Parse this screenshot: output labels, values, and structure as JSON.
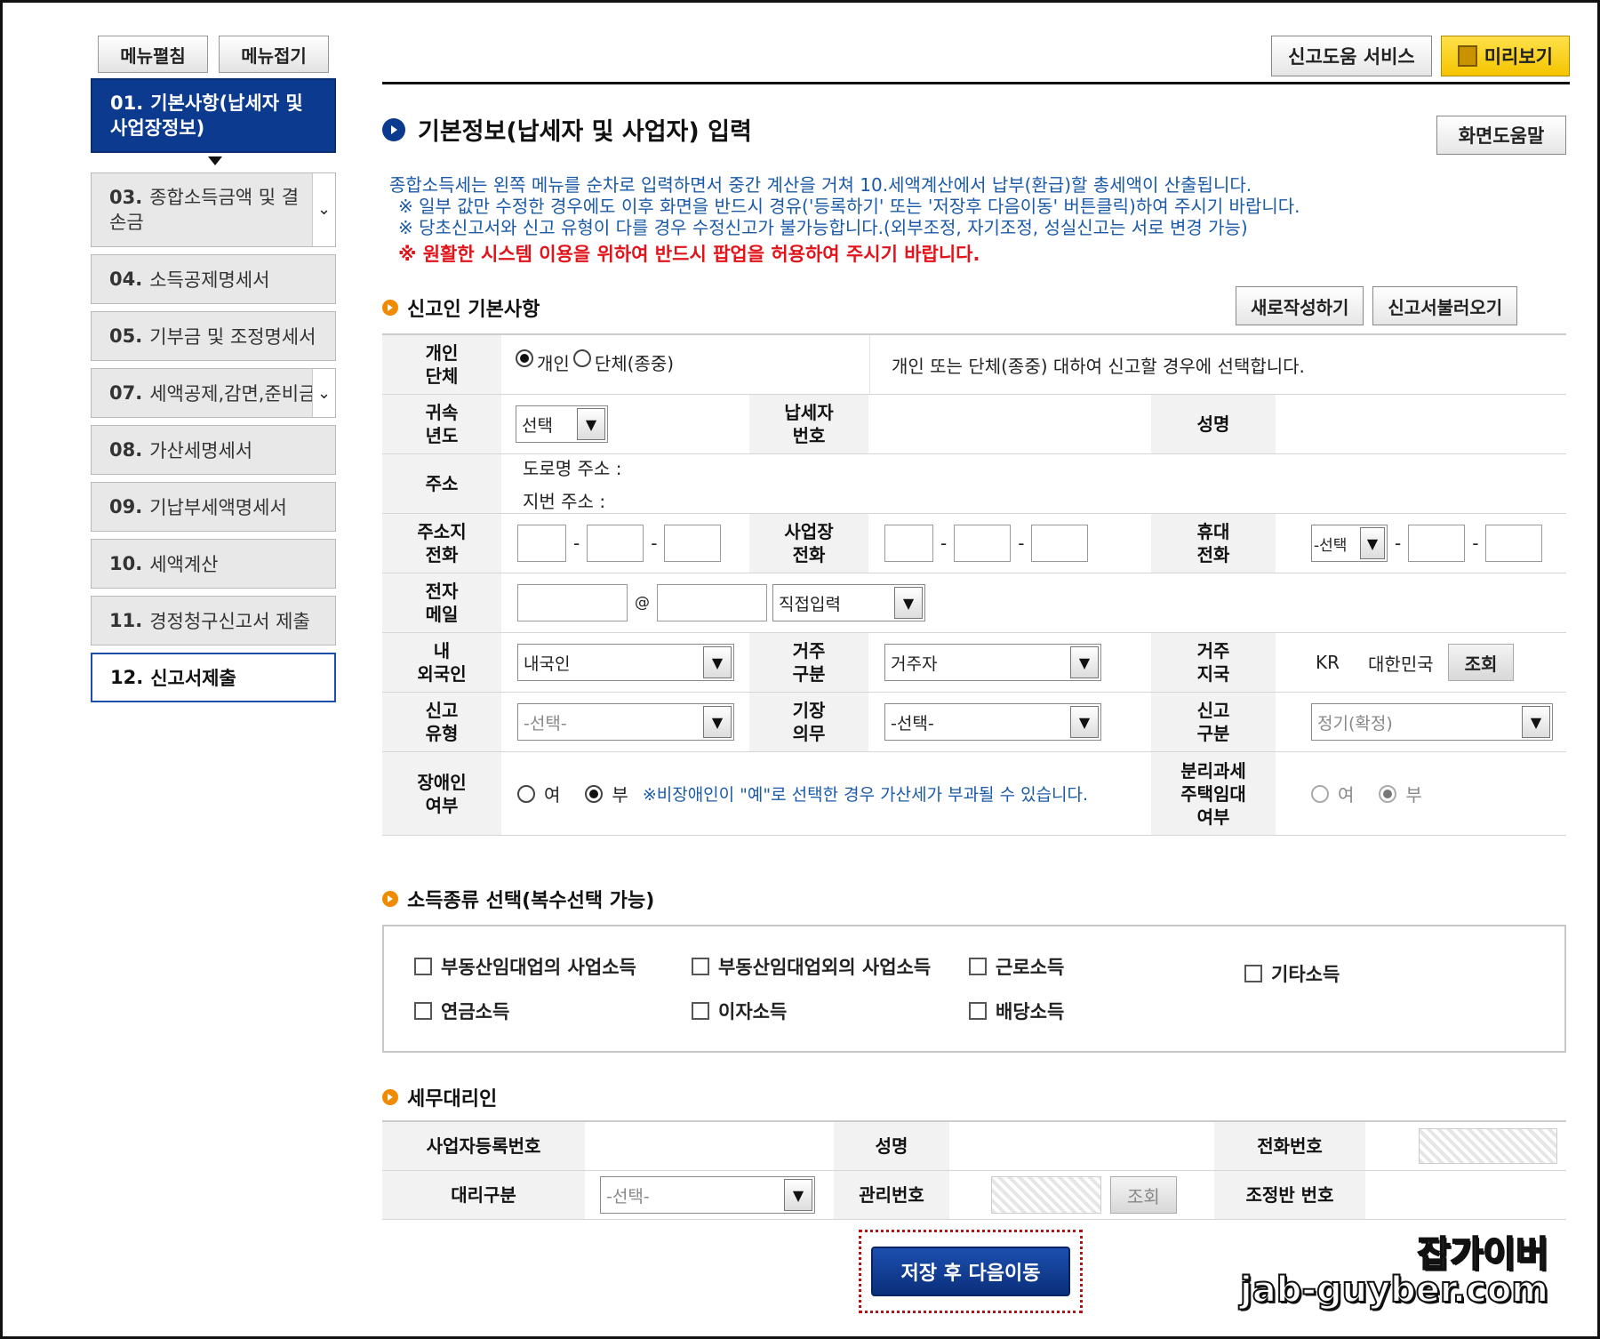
{
  "menu_buttons": {
    "expand": "메뉴펼침",
    "collapse": "메뉴접기"
  },
  "sidebar": {
    "items": [
      {
        "num": "01.",
        "label": "기본사항(납세자 및 사업장정보)"
      },
      {
        "num": "03.",
        "label": "종합소득금액 및 결손금"
      },
      {
        "num": "04.",
        "label": "소득공제명세서"
      },
      {
        "num": "05.",
        "label": "기부금 및 조정명세서"
      },
      {
        "num": "07.",
        "label": "세액공제,감면,준비금"
      },
      {
        "num": "08.",
        "label": "가산세명세서"
      },
      {
        "num": "09.",
        "label": "기납부세액명세서"
      },
      {
        "num": "10.",
        "label": "세액계산"
      },
      {
        "num": "11.",
        "label": "경정청구신고서 제출"
      },
      {
        "num": "12.",
        "label": "신고서제출"
      }
    ]
  },
  "top_buttons": {
    "help_service": "신고도움 서비스",
    "preview": "미리보기"
  },
  "page": {
    "title": "기본정보(납세자 및 사업자) 입력",
    "screen_help": "화면도움말",
    "notice_lines": [
      "종합소득세는 왼쪽 메뉴를 순차로 입력하면서 중간 계산을 거쳐 10.세액계산에서 납부(환급)할 총세액이 산출됩니다.",
      "※ 일부 값만 수정한 경우에도 이후 화면을 반드시 경유('등록하기' 또는 '저장후 다음이동' 버튼클릭)하여 주시기 바랍니다.",
      "※ 당초신고서와 신고 유형이 다를 경우 수정신고가 불가능합니다.(외부조정, 자기조정, 성실신고는 서로 변경 가능)"
    ],
    "notice_red": "※ 원활한 시스템 이용을 위하여 반드시 팝업을 허용하여 주시기 바랍니다."
  },
  "reporter_section": {
    "heading": "신고인 기본사항",
    "new_button": "새로작성하기",
    "load_button": "신고서불러오기",
    "labels": {
      "indiv_group": "개인\n단체",
      "year": "귀속\n년도",
      "tin": "납세자\n번호",
      "name": "성명",
      "address": "주소",
      "home_phone": "주소지\n전화",
      "biz_phone": "사업장\n전화",
      "mobile": "휴대\n전화",
      "email": "전자\n메일",
      "nationality": "내\n외국인",
      "residence": "거주\n구분",
      "res_country": "거주\n지국",
      "report_type": "신고\n유형",
      "bookkeeping": "기장\n의무",
      "report_class": "신고\n구분",
      "disabled": "장애인\n여부",
      "separate_tax": "분리과세\n주택임대\n여부"
    },
    "indiv_option": "개인",
    "group_option": "단체(종중)",
    "indiv_desc": "개인 또는 단체(종중) 대하여 신고할 경우에 선택합니다.",
    "year_select": "선택",
    "road_address": "도로명 주소 :",
    "lot_address": "지번 주소 :",
    "mobile_select": "-선택",
    "email_at": "@",
    "email_domain": "직접입력",
    "nationality_value": "내국인",
    "residence_value": "거주자",
    "country_code": "KR",
    "country_name": "대한민국",
    "lookup": "조회",
    "report_type_value": "-선택-",
    "bookkeeping_value": "-선택-",
    "report_class_value": "정기(확정)",
    "yes": "여",
    "no": "부",
    "disabled_note": "※비장애인이 \"예\"로 선택한 경우 가산세가 부과될 수 있습니다."
  },
  "income_section": {
    "heading": "소득종류 선택(복수선택 가능)",
    "options": [
      "부동산임대업의 사업소득",
      "부동산임대업외의 사업소득",
      "근로소득",
      "기타소득",
      "연금소득",
      "이자소득",
      "배당소득"
    ]
  },
  "agent_section": {
    "heading": "세무대리인",
    "biz_reg_no": "사업자등록번호",
    "name": "성명",
    "phone": "전화번호",
    "agent_type": "대리구분",
    "agent_type_value": "-선택-",
    "mgmt_no": "관리번호",
    "lookup": "조회",
    "team_no": "조정반 번호"
  },
  "save_button": "저장 후 다음이동",
  "watermark": {
    "line1": "잡가이버",
    "line2": "jab-guyber.com"
  }
}
